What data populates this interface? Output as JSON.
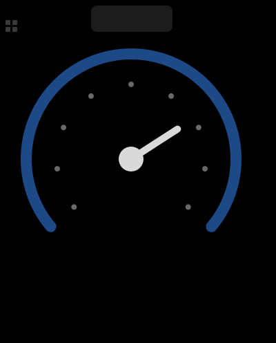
{
  "header": {
    "label": ""
  },
  "gauge": {
    "level": 0.72,
    "arc_color": "#1d4a86",
    "needle_color": "#d9d9d9",
    "tick_color": "#bfbfbf"
  },
  "readout": {
    "value_text": "",
    "unit_text": ""
  },
  "icons": {
    "corner": "grid-icon"
  }
}
